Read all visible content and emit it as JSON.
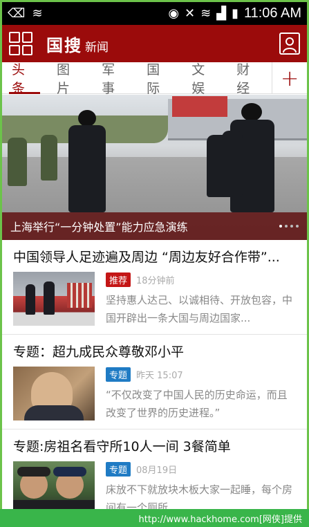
{
  "status": {
    "time": "11:06 AM"
  },
  "header": {
    "logo_main": "国搜",
    "logo_sub": "新闻"
  },
  "tabs": [
    {
      "label": "头条",
      "active": true
    },
    {
      "label": "图片"
    },
    {
      "label": "军事"
    },
    {
      "label": "国际"
    },
    {
      "label": "文娱"
    },
    {
      "label": "财经"
    }
  ],
  "tab_add": "+",
  "hero": {
    "caption": "上海举行“一分钟处置”能力应急演练"
  },
  "news": [
    {
      "title": "中国领导人足迹遍及周边 “周边友好合作带”...",
      "badge": "推荐",
      "badge_color": "#c41616",
      "time": "18分钟前",
      "summary": "坚持惠人达己、以诚相待、开放包容，中国开辟出一条大国与周边国家..."
    },
    {
      "title": "专题：超九成民众尊敬邓小平",
      "badge": "专题",
      "badge_color": "#1f7bc4",
      "time": "昨天 15:07",
      "summary": "“不仅改变了中国人民的历史命运，而且改变了世界的历史进程。”"
    },
    {
      "title": "专题:房祖名看守所10人一间 3餐简单",
      "badge": "专题",
      "badge_color": "#1f7bc4",
      "time": "08月19日",
      "summary": "床放不下就放块木板大家一起睡，每个房间有一个厕所..."
    }
  ],
  "watermark": "http://www.hackhome.com[网侠]提供"
}
